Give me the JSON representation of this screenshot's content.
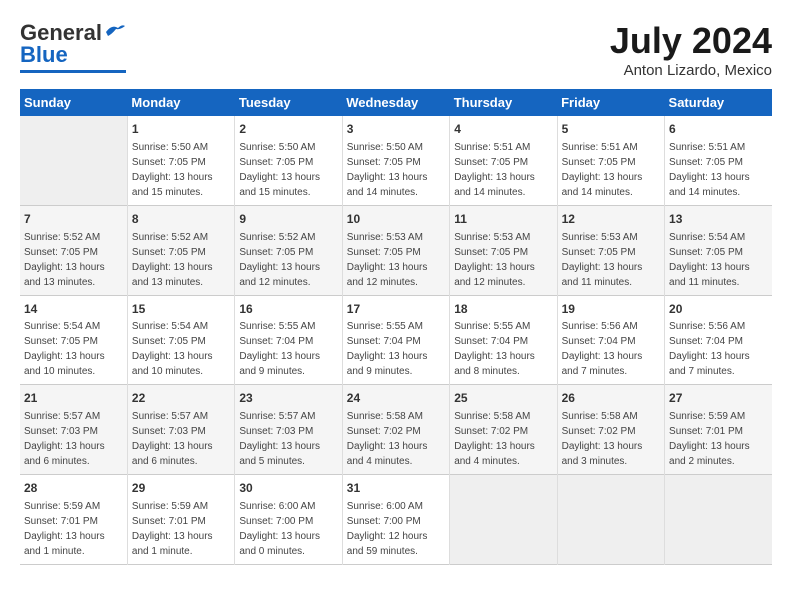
{
  "logo": {
    "general": "General",
    "blue": "Blue"
  },
  "title": {
    "month_year": "July 2024",
    "location": "Anton Lizardo, Mexico"
  },
  "calendar": {
    "headers": [
      "Sunday",
      "Monday",
      "Tuesday",
      "Wednesday",
      "Thursday",
      "Friday",
      "Saturday"
    ],
    "weeks": [
      [
        {
          "day": "",
          "info": ""
        },
        {
          "day": "1",
          "info": "Sunrise: 5:50 AM\nSunset: 7:05 PM\nDaylight: 13 hours\nand 15 minutes."
        },
        {
          "day": "2",
          "info": "Sunrise: 5:50 AM\nSunset: 7:05 PM\nDaylight: 13 hours\nand 15 minutes."
        },
        {
          "day": "3",
          "info": "Sunrise: 5:50 AM\nSunset: 7:05 PM\nDaylight: 13 hours\nand 14 minutes."
        },
        {
          "day": "4",
          "info": "Sunrise: 5:51 AM\nSunset: 7:05 PM\nDaylight: 13 hours\nand 14 minutes."
        },
        {
          "day": "5",
          "info": "Sunrise: 5:51 AM\nSunset: 7:05 PM\nDaylight: 13 hours\nand 14 minutes."
        },
        {
          "day": "6",
          "info": "Sunrise: 5:51 AM\nSunset: 7:05 PM\nDaylight: 13 hours\nand 14 minutes."
        }
      ],
      [
        {
          "day": "7",
          "info": "Sunrise: 5:52 AM\nSunset: 7:05 PM\nDaylight: 13 hours\nand 13 minutes."
        },
        {
          "day": "8",
          "info": "Sunrise: 5:52 AM\nSunset: 7:05 PM\nDaylight: 13 hours\nand 13 minutes."
        },
        {
          "day": "9",
          "info": "Sunrise: 5:52 AM\nSunset: 7:05 PM\nDaylight: 13 hours\nand 12 minutes."
        },
        {
          "day": "10",
          "info": "Sunrise: 5:53 AM\nSunset: 7:05 PM\nDaylight: 13 hours\nand 12 minutes."
        },
        {
          "day": "11",
          "info": "Sunrise: 5:53 AM\nSunset: 7:05 PM\nDaylight: 13 hours\nand 12 minutes."
        },
        {
          "day": "12",
          "info": "Sunrise: 5:53 AM\nSunset: 7:05 PM\nDaylight: 13 hours\nand 11 minutes."
        },
        {
          "day": "13",
          "info": "Sunrise: 5:54 AM\nSunset: 7:05 PM\nDaylight: 13 hours\nand 11 minutes."
        }
      ],
      [
        {
          "day": "14",
          "info": "Sunrise: 5:54 AM\nSunset: 7:05 PM\nDaylight: 13 hours\nand 10 minutes."
        },
        {
          "day": "15",
          "info": "Sunrise: 5:54 AM\nSunset: 7:05 PM\nDaylight: 13 hours\nand 10 minutes."
        },
        {
          "day": "16",
          "info": "Sunrise: 5:55 AM\nSunset: 7:04 PM\nDaylight: 13 hours\nand 9 minutes."
        },
        {
          "day": "17",
          "info": "Sunrise: 5:55 AM\nSunset: 7:04 PM\nDaylight: 13 hours\nand 9 minutes."
        },
        {
          "day": "18",
          "info": "Sunrise: 5:55 AM\nSunset: 7:04 PM\nDaylight: 13 hours\nand 8 minutes."
        },
        {
          "day": "19",
          "info": "Sunrise: 5:56 AM\nSunset: 7:04 PM\nDaylight: 13 hours\nand 7 minutes."
        },
        {
          "day": "20",
          "info": "Sunrise: 5:56 AM\nSunset: 7:04 PM\nDaylight: 13 hours\nand 7 minutes."
        }
      ],
      [
        {
          "day": "21",
          "info": "Sunrise: 5:57 AM\nSunset: 7:03 PM\nDaylight: 13 hours\nand 6 minutes."
        },
        {
          "day": "22",
          "info": "Sunrise: 5:57 AM\nSunset: 7:03 PM\nDaylight: 13 hours\nand 6 minutes."
        },
        {
          "day": "23",
          "info": "Sunrise: 5:57 AM\nSunset: 7:03 PM\nDaylight: 13 hours\nand 5 minutes."
        },
        {
          "day": "24",
          "info": "Sunrise: 5:58 AM\nSunset: 7:02 PM\nDaylight: 13 hours\nand 4 minutes."
        },
        {
          "day": "25",
          "info": "Sunrise: 5:58 AM\nSunset: 7:02 PM\nDaylight: 13 hours\nand 4 minutes."
        },
        {
          "day": "26",
          "info": "Sunrise: 5:58 AM\nSunset: 7:02 PM\nDaylight: 13 hours\nand 3 minutes."
        },
        {
          "day": "27",
          "info": "Sunrise: 5:59 AM\nSunset: 7:01 PM\nDaylight: 13 hours\nand 2 minutes."
        }
      ],
      [
        {
          "day": "28",
          "info": "Sunrise: 5:59 AM\nSunset: 7:01 PM\nDaylight: 13 hours\nand 1 minute."
        },
        {
          "day": "29",
          "info": "Sunrise: 5:59 AM\nSunset: 7:01 PM\nDaylight: 13 hours\nand 1 minute."
        },
        {
          "day": "30",
          "info": "Sunrise: 6:00 AM\nSunset: 7:00 PM\nDaylight: 13 hours\nand 0 minutes."
        },
        {
          "day": "31",
          "info": "Sunrise: 6:00 AM\nSunset: 7:00 PM\nDaylight: 12 hours\nand 59 minutes."
        },
        {
          "day": "",
          "info": ""
        },
        {
          "day": "",
          "info": ""
        },
        {
          "day": "",
          "info": ""
        }
      ]
    ]
  }
}
